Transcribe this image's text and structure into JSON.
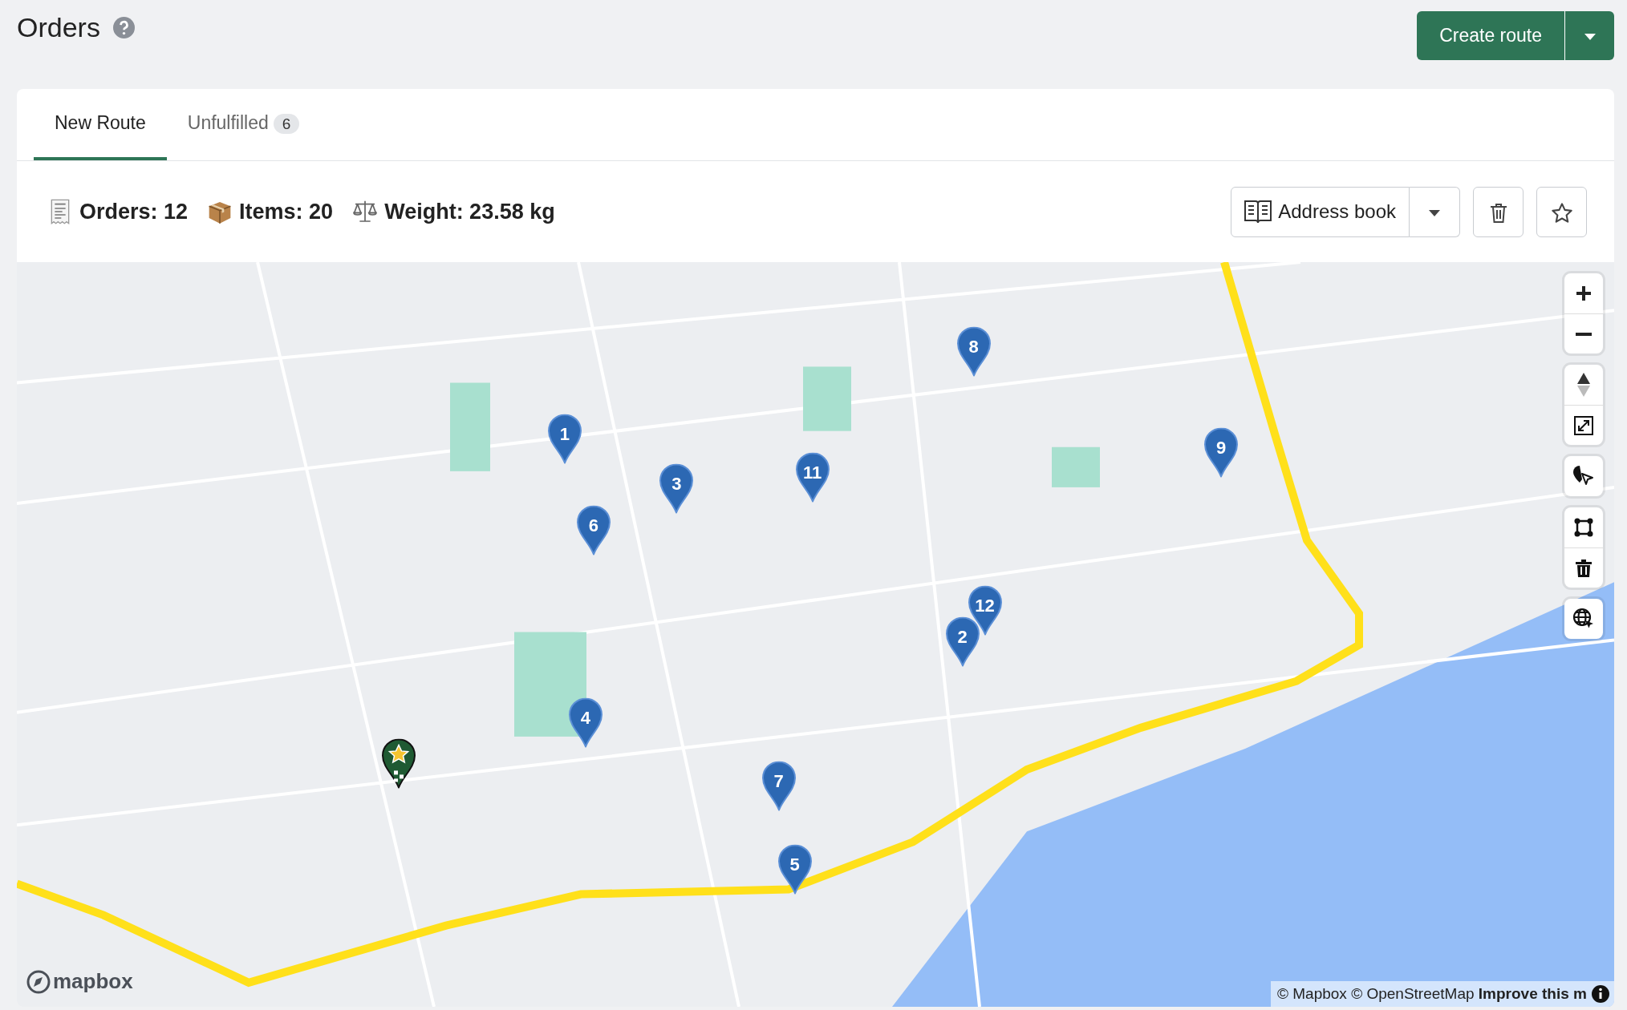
{
  "header": {
    "title": "Orders",
    "primary_button": "Create route"
  },
  "tabs": [
    {
      "label": "New Route",
      "selected": true
    },
    {
      "label": "Unfulfilled",
      "count": "6",
      "selected": false
    }
  ],
  "stats": [
    {
      "kind": "orders",
      "text": "Orders: 12"
    },
    {
      "kind": "items",
      "text": "Items: 20"
    },
    {
      "kind": "weight",
      "text": "Weight: 23.58 kg"
    }
  ],
  "toolbar": {
    "address_book": "Address book"
  },
  "map": {
    "pins": [
      {
        "kind": "stop",
        "label": "1"
      },
      {
        "kind": "stop",
        "label": "2"
      },
      {
        "kind": "stop",
        "label": "3"
      },
      {
        "kind": "stop",
        "label": "4"
      },
      {
        "kind": "stop",
        "label": "5"
      },
      {
        "kind": "stop",
        "label": "6"
      },
      {
        "kind": "stop",
        "label": "7"
      },
      {
        "kind": "stop",
        "label": "8"
      },
      {
        "kind": "stop",
        "label": "9"
      },
      {
        "kind": "stop",
        "label": "11"
      },
      {
        "kind": "stop",
        "label": "12"
      },
      {
        "kind": "depot"
      }
    ],
    "logo": "mapbox",
    "attribution": "© Mapbox © OpenStreetMap **Improve this m**"
  }
}
